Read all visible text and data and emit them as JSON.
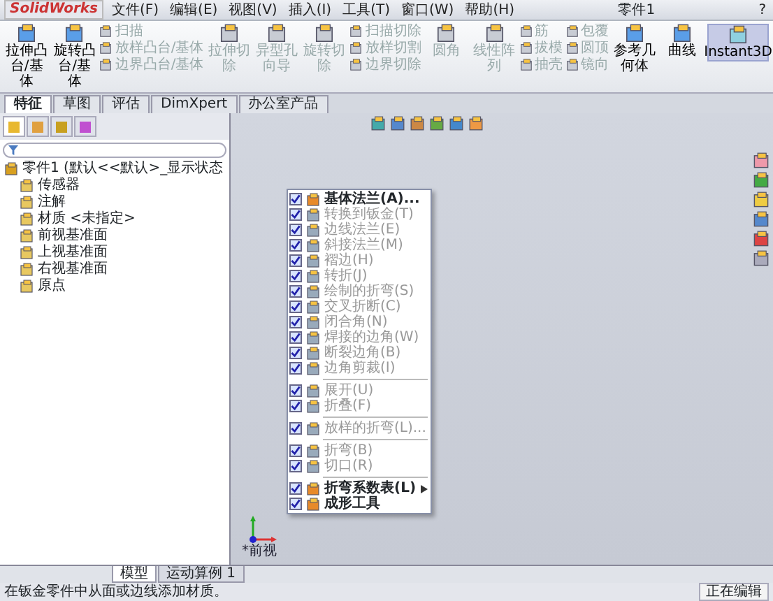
{
  "title_bar": {
    "app": "SolidWorks",
    "menus": [
      "文件(F)",
      "编辑(E)",
      "视图(V)",
      "插入(I)",
      "工具(T)",
      "窗口(W)",
      "帮助(H)"
    ],
    "title": "零件1",
    "help": "?"
  },
  "ribbon": [
    {
      "kind": "large",
      "label": "拉伸凸台/基体",
      "disabled": false
    },
    {
      "kind": "large",
      "label": "旋转凸台/基体",
      "disabled": false
    },
    {
      "kind": "small",
      "label": "扫描",
      "disabled": true
    },
    {
      "kind": "small",
      "label": "放样凸台/基体",
      "disabled": true
    },
    {
      "kind": "small",
      "label": "边界凸台/基体",
      "disabled": true
    },
    {
      "kind": "large",
      "label": "拉伸切除",
      "disabled": true
    },
    {
      "kind": "large",
      "label": "异型孔向导",
      "disabled": true
    },
    {
      "kind": "large",
      "label": "旋转切除",
      "disabled": true
    },
    {
      "kind": "small",
      "label": "扫描切除",
      "disabled": true
    },
    {
      "kind": "small",
      "label": "放样切割",
      "disabled": true
    },
    {
      "kind": "small",
      "label": "边界切除",
      "disabled": true
    },
    {
      "kind": "large",
      "label": "圆角",
      "disabled": true
    },
    {
      "kind": "large",
      "label": "线性阵列",
      "disabled": true
    },
    {
      "kind": "small",
      "label": "筋",
      "disabled": true
    },
    {
      "kind": "small",
      "label": "拔模",
      "disabled": true
    },
    {
      "kind": "small",
      "label": "抽壳",
      "disabled": true
    },
    {
      "kind": "small",
      "label": "包覆",
      "disabled": true
    },
    {
      "kind": "small",
      "label": "圆顶",
      "disabled": true
    },
    {
      "kind": "small",
      "label": "镜向",
      "disabled": true
    },
    {
      "kind": "large",
      "label": "参考几何体",
      "disabled": false
    },
    {
      "kind": "large",
      "label": "曲线",
      "disabled": false
    },
    {
      "kind": "toggle",
      "label": "Instant3D",
      "disabled": false
    }
  ],
  "command_tabs": [
    {
      "label": "特征",
      "selected": true
    },
    {
      "label": "草图",
      "selected": false
    },
    {
      "label": "评估",
      "selected": false
    },
    {
      "label": "DimXpert",
      "selected": false
    },
    {
      "label": "办公室产品",
      "selected": false
    }
  ],
  "panel_tabs": [
    {
      "selected": true
    },
    {
      "selected": false
    },
    {
      "selected": false
    },
    {
      "selected": false
    }
  ],
  "feature_tree": {
    "label": "零件1 (默认<<默认>_显示状态",
    "children": [
      {
        "label": "传感器"
      },
      {
        "label": "注解"
      },
      {
        "label": "材质 <未指定>"
      },
      {
        "label": "前视基准面"
      },
      {
        "label": "上视基准面"
      },
      {
        "label": "右视基准面"
      },
      {
        "label": "原点"
      }
    ]
  },
  "menu": [
    {
      "kind": "item",
      "label": "基体法兰(A)...",
      "checked": true,
      "disabled": false
    },
    {
      "kind": "item",
      "label": "转换到钣金(T)",
      "checked": true,
      "disabled": true
    },
    {
      "kind": "item",
      "label": "边线法兰(E)",
      "checked": true,
      "disabled": true
    },
    {
      "kind": "item",
      "label": "斜接法兰(M)",
      "checked": true,
      "disabled": true
    },
    {
      "kind": "item",
      "label": "褶边(H)",
      "checked": true,
      "disabled": true
    },
    {
      "kind": "item",
      "label": "转折(J)",
      "checked": true,
      "disabled": true
    },
    {
      "kind": "item",
      "label": "绘制的折弯(S)",
      "checked": true,
      "disabled": true
    },
    {
      "kind": "item",
      "label": "交叉折断(C)",
      "checked": true,
      "disabled": true
    },
    {
      "kind": "item",
      "label": "闭合角(N)",
      "checked": true,
      "disabled": true
    },
    {
      "kind": "item",
      "label": "焊接的边角(W)",
      "checked": true,
      "disabled": true
    },
    {
      "kind": "item",
      "label": "断裂边角(B)",
      "checked": true,
      "disabled": true
    },
    {
      "kind": "item",
      "label": "边角剪裁(I)",
      "checked": true,
      "disabled": true
    },
    {
      "kind": "separator"
    },
    {
      "kind": "item",
      "label": "展开(U)",
      "checked": true,
      "disabled": true
    },
    {
      "kind": "item",
      "label": "折叠(F)",
      "checked": true,
      "disabled": true
    },
    {
      "kind": "separator"
    },
    {
      "kind": "item",
      "label": "放样的折弯(L)...",
      "checked": true,
      "disabled": true
    },
    {
      "kind": "separator"
    },
    {
      "kind": "item",
      "label": "折弯(B)",
      "checked": true,
      "disabled": true
    },
    {
      "kind": "item",
      "label": "切口(R)",
      "checked": true,
      "disabled": true
    },
    {
      "kind": "separator"
    },
    {
      "kind": "submenu",
      "label": "折弯系数表(L)",
      "checked": true,
      "disabled": false
    },
    {
      "kind": "item",
      "label": "成形工具",
      "checked": true,
      "disabled": false
    }
  ],
  "view_label": "*前视",
  "bottom_tabs": [
    {
      "label": "模型",
      "selected": true
    },
    {
      "label": "运动算例 1",
      "selected": false
    }
  ],
  "status_bar": {
    "message": "在钣金零件中从面或边线添加材质。",
    "mode": "正在编辑"
  }
}
